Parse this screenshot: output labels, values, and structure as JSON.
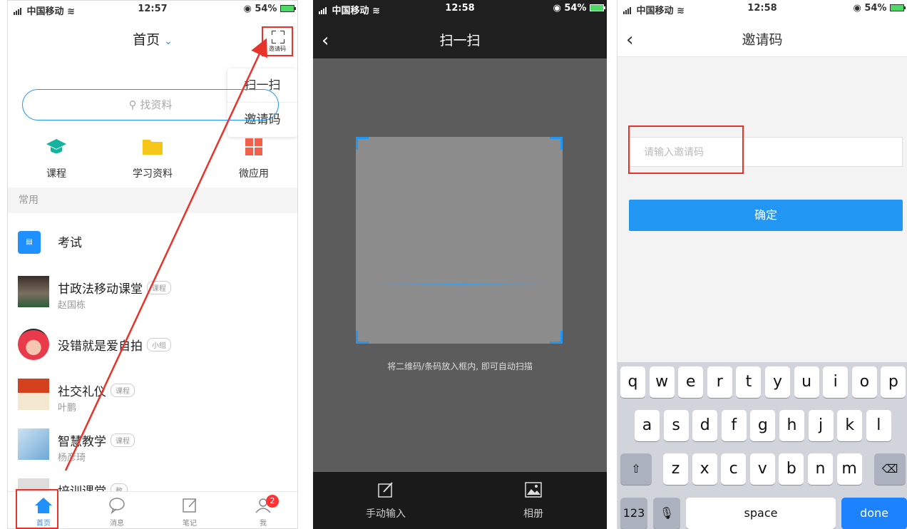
{
  "screen1": {
    "status": {
      "carrier": "中国移动",
      "time": "12:57",
      "battery": "54%"
    },
    "title": "首页",
    "scan_label": "邀请码",
    "dropdown": [
      "扫一扫",
      "邀请码"
    ],
    "search_placeholder": "找资料",
    "quick": [
      {
        "label": "课程",
        "icon": "graduation-cap-icon",
        "color": "#14b39e"
      },
      {
        "label": "学习资料",
        "icon": "folder-icon",
        "color": "#f5c518"
      },
      {
        "label": "微应用",
        "icon": "grid-icon",
        "color": "#f0604a"
      }
    ],
    "section": "常用",
    "rows": [
      {
        "title": "考试",
        "tag": "",
        "sub": ""
      },
      {
        "title": "甘政法移动课堂",
        "tag": "课程",
        "sub": "赵国栋"
      },
      {
        "title": "没错就是爱自拍",
        "tag": "小组",
        "sub": ""
      },
      {
        "title": "社交礼仪",
        "tag": "课程",
        "sub": "叶鹏"
      },
      {
        "title": "智慧教学",
        "tag": "课程",
        "sub": "杨彦琦"
      },
      {
        "title": "培训课堂",
        "tag": "教",
        "sub": ""
      }
    ],
    "tabs": [
      "首页",
      "消息",
      "笔记",
      "我"
    ],
    "badge": "2"
  },
  "screen2": {
    "status": {
      "carrier": "中国移动",
      "time": "12:58",
      "battery": "54%"
    },
    "title": "扫一扫",
    "hint": "将二维码/条码放入框内, 即可自动扫描",
    "manual": "手动输入",
    "album": "相册"
  },
  "screen3": {
    "status": {
      "carrier": "中国移动",
      "time": "12:58",
      "battery": "54%"
    },
    "title": "邀请码",
    "placeholder": "请输入邀请码",
    "confirm": "确定",
    "keys_row1": [
      "q",
      "w",
      "e",
      "r",
      "t",
      "y",
      "u",
      "i",
      "o",
      "p"
    ],
    "keys_row2": [
      "a",
      "s",
      "d",
      "f",
      "g",
      "h",
      "j",
      "k",
      "l"
    ],
    "keys_row3": [
      "z",
      "x",
      "c",
      "v",
      "b",
      "n",
      "m"
    ],
    "key_123": "123",
    "key_space": "space",
    "key_done": "done"
  },
  "colors": {
    "accent": "#2196f3",
    "highlight": "#e8332b"
  }
}
